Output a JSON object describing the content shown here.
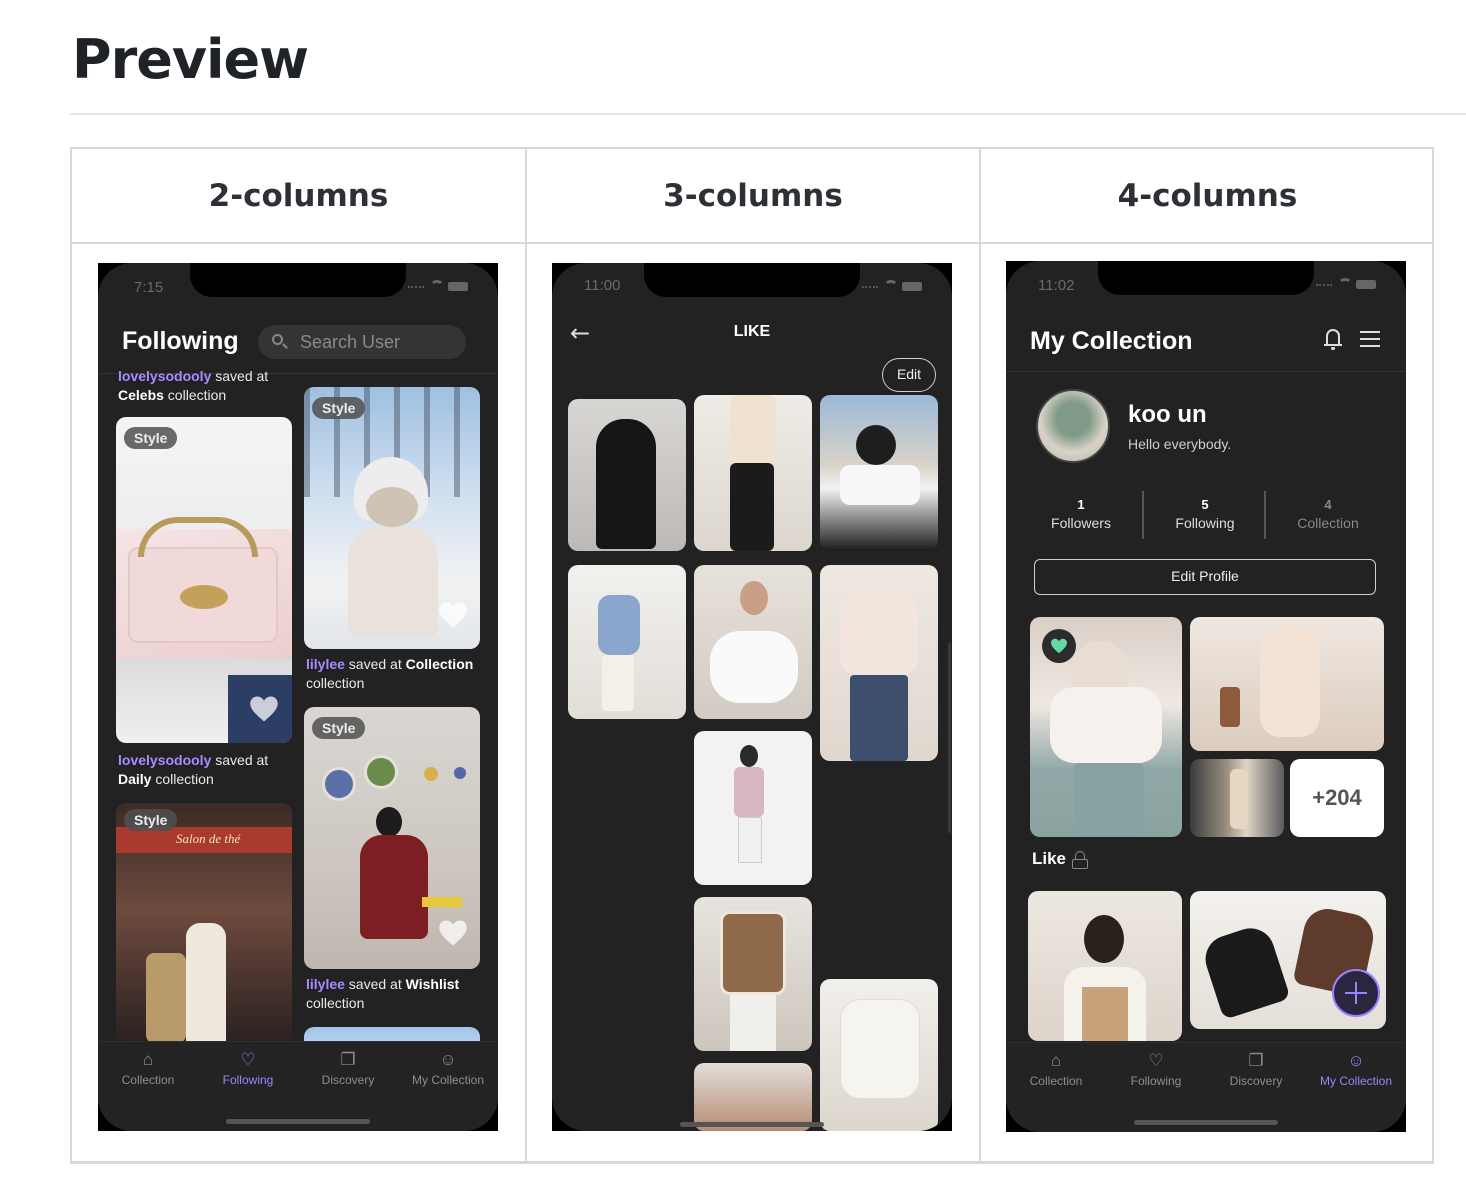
{
  "page": {
    "title": "Preview"
  },
  "table": {
    "headers": [
      "2-columns",
      "3-columns",
      "4-columns"
    ]
  },
  "phone1": {
    "time": "7:15",
    "title": "Following",
    "search_placeholder": "Search User",
    "top_caption": {
      "user": "lovelysodooly",
      "action": " saved at ",
      "name": "Celebs",
      "suffix": " collection"
    },
    "tag": "Style",
    "captions": [
      {
        "user": "lilylee",
        "action": " saved at ",
        "name": "Collection",
        "suffix": "collection"
      },
      {
        "user": "lovelysodooly",
        "action": " saved at",
        "name": "Daily",
        "suffix": " collection"
      },
      {
        "user": "lilylee",
        "action": " saved at ",
        "name": "Wishlist",
        "suffix": "collection"
      }
    ],
    "sign_text": "Salon de thé"
  },
  "phone2": {
    "time": "11:00",
    "title": "LIKE",
    "edit_label": "Edit"
  },
  "phone3": {
    "time": "11:02",
    "title": "My Collection",
    "profile": {
      "name": "koo un",
      "bio": "Hello everybody."
    },
    "stats": [
      {
        "value": "1",
        "label": "Followers"
      },
      {
        "value": "5",
        "label": "Following"
      },
      {
        "value": "4",
        "label": "Collection"
      }
    ],
    "edit_profile_label": "Edit Profile",
    "more_count": "+204",
    "like_label": "Like"
  },
  "tabbar": {
    "items": [
      "Collection",
      "Following",
      "Discovery",
      "My Collection"
    ]
  },
  "colors": {
    "accent": "#9b83ff",
    "phone_bg": "#222223",
    "like_heart": "#63d7a4"
  }
}
